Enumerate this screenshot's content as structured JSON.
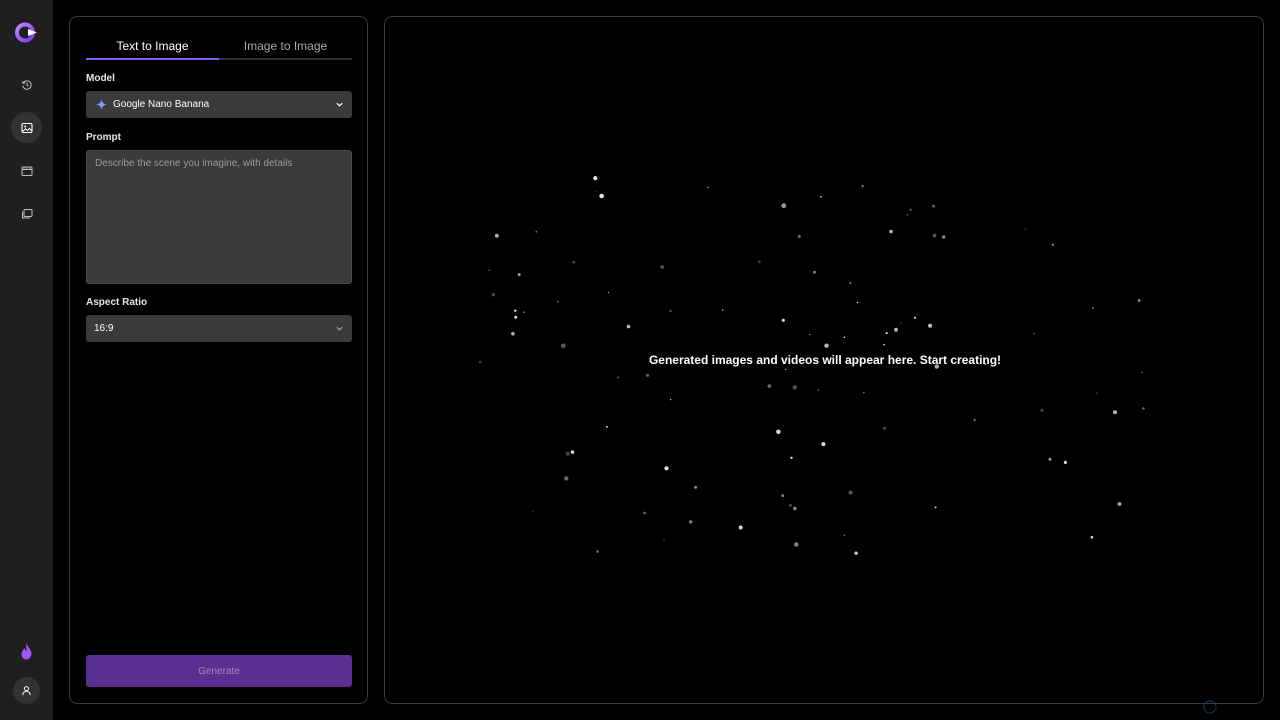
{
  "app": {
    "logo_icon": "app-logo-icon",
    "accent_color": "#8b5cf6"
  },
  "rail": {
    "items": [
      {
        "icon": "history-icon",
        "active": false
      },
      {
        "icon": "image-icon",
        "active": true
      },
      {
        "icon": "video-icon",
        "active": false
      },
      {
        "icon": "gallery-icon",
        "active": false
      }
    ],
    "credits_icon": "flame-icon",
    "account_icon": "user-icon"
  },
  "tabs": [
    {
      "label": "Text to Image",
      "active": true
    },
    {
      "label": "Image to Image",
      "active": false
    }
  ],
  "form": {
    "model_label": "Model",
    "model_value": "Google Nano Banana",
    "model_icon": "gemini-sparkle-icon",
    "prompt_label": "Prompt",
    "prompt_placeholder": "Describe the scene you imagine, with details",
    "prompt_value": "",
    "aspect_label": "Aspect Ratio",
    "aspect_value": "16:9",
    "generate_label": "Generate"
  },
  "preview": {
    "empty_message": "Generated images and videos will appear here. Start creating!"
  }
}
